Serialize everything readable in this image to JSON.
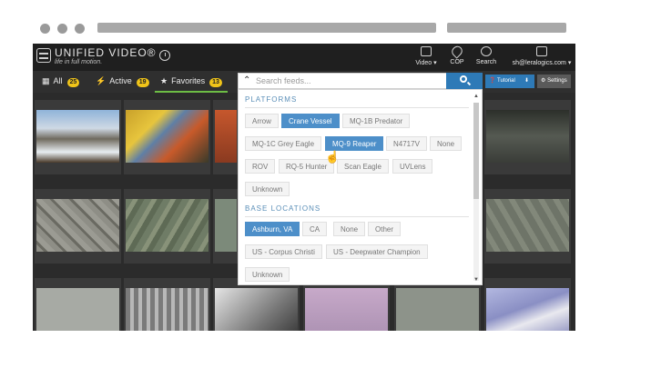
{
  "app": {
    "brand": "UNIFIED VIDEO®",
    "tagline": "life in full motion."
  },
  "nav": [
    {
      "label": "Video ▾",
      "icon": "monitor-icon"
    },
    {
      "label": "COP",
      "icon": "map-pin-icon"
    },
    {
      "label": "Search",
      "icon": "binoculars-icon"
    },
    {
      "label": "sh@leralogics.com ▾",
      "icon": "user-badge-icon"
    }
  ],
  "tabs": {
    "all": {
      "label": "All",
      "count": "25"
    },
    "active": {
      "label": "Active",
      "count": "19"
    },
    "favorites": {
      "label": "Favorites",
      "count": "13"
    }
  },
  "toolbar": {
    "tutorial": "Tutorial",
    "settings": "Settings"
  },
  "search": {
    "placeholder": "Search feeds..."
  },
  "filters": {
    "platforms_title": "PLATFORMS",
    "platforms": [
      "Arrow",
      "Crane Vessel",
      "MQ-1B Predator",
      "MQ-1C Grey Eagle",
      "MQ-9 Reaper",
      "N4717V",
      "None",
      "ROV",
      "RQ-5 Hunter",
      "Scan Eagle",
      "UVLens",
      "Unknown"
    ],
    "selected_platforms": [
      "Crane Vessel",
      "MQ-9 Reaper"
    ],
    "locations_title": "BASE LOCATIONS",
    "locations": [
      "Ashburn, VA",
      "CA",
      "None",
      "Other",
      "US - Corpus Christi",
      "US - Deepwater Champion",
      "Unknown"
    ],
    "selected_locations": [
      "Ashburn, VA"
    ]
  },
  "colors": {
    "accent_blue": "#2e7ab7",
    "badge_yellow": "#f0c419",
    "favorites_underline": "#6dbd45",
    "chip_selected": "#4d8fc9"
  }
}
